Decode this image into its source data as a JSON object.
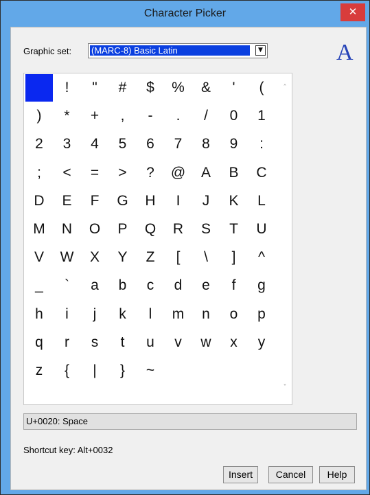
{
  "window": {
    "title": "Character Picker",
    "close_glyph": "✕"
  },
  "graphic_set": {
    "label": "Graphic set:",
    "selected": "(MARC-8) Basic Latin",
    "dropdown_glyph": "▼"
  },
  "font_preview": {
    "glyph": "A",
    "color": "#2744b8"
  },
  "characters": [
    " ",
    "!",
    "\"",
    "#",
    "$",
    "%",
    "&",
    "'",
    "(",
    ")",
    "*",
    "+",
    ",",
    "-",
    ".",
    "/",
    "0",
    "1",
    "2",
    "3",
    "4",
    "5",
    "6",
    "7",
    "8",
    "9",
    ":",
    ";",
    "<",
    "=",
    ">",
    "?",
    "@",
    "A",
    "B",
    "C",
    "D",
    "E",
    "F",
    "G",
    "H",
    "I",
    "J",
    "K",
    "L",
    "M",
    "N",
    "O",
    "P",
    "Q",
    "R",
    "S",
    "T",
    "U",
    "V",
    "W",
    "X",
    "Y",
    "Z",
    "[",
    "\\",
    "]",
    "^",
    "_",
    "`",
    "a",
    "b",
    "c",
    "d",
    "e",
    "f",
    "g",
    "h",
    "i",
    "j",
    "k",
    "l",
    "m",
    "n",
    "o",
    "p",
    "q",
    "r",
    "s",
    "t",
    "u",
    "v",
    "w",
    "x",
    "y",
    "z",
    "{",
    "|",
    "}",
    "~"
  ],
  "selected_index": 0,
  "scroll": {
    "up_glyph": "˄",
    "down_glyph": "˅"
  },
  "info": {
    "code_point": "U+0020: Space"
  },
  "shortcut": {
    "text": "Shortcut key: Alt+0032"
  },
  "buttons": {
    "insert": "Insert",
    "cancel": "Cancel",
    "help": "Help"
  },
  "colors": {
    "titlebar": "#62a8e8",
    "selection": "#0a28f0",
    "close": "#d83c3c"
  }
}
